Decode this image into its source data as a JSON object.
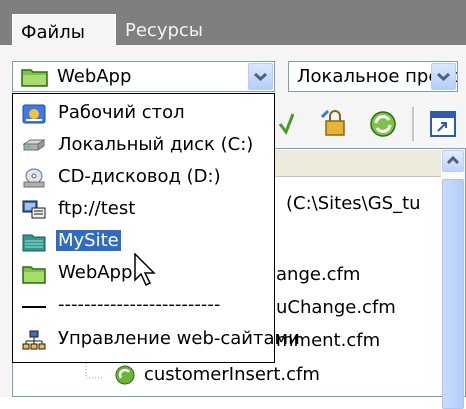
{
  "tabs": [
    {
      "label": "Файлы",
      "active": true
    },
    {
      "label": "Ресурсы",
      "active": false
    }
  ],
  "site_select": {
    "value": "WebApp"
  },
  "view_select": {
    "value": "Локальное представление"
  },
  "file_list": {
    "path_fragment": "(C:\\Sites\\GS_tu",
    "items": [
      "ange.cfm",
      "uChange.cfm",
      "mment.cfm",
      "customerInsert.cfm"
    ]
  },
  "dropdown": {
    "items": [
      {
        "label": "Рабочий стол",
        "icon": "desktop-icon"
      },
      {
        "label": "Локальный диск (C:)",
        "icon": "hard-drive-icon"
      },
      {
        "label": "CD-дисковод (D:)",
        "icon": "cd-drive-icon"
      },
      {
        "label": "ftp://test",
        "icon": "ftp-server-icon"
      },
      {
        "label": "MySite",
        "icon": "site-icon",
        "selected": true
      },
      {
        "label": "WebApp",
        "icon": "folder-icon"
      },
      {
        "label": "-------------------------",
        "icon": "line-icon"
      },
      {
        "label": "Управление web-сайтами",
        "icon": "manage-sites-icon"
      }
    ]
  },
  "colors": {
    "tab_strip": "#7f7f7f",
    "panel": "#f5f5f5",
    "selection": "#316ac5",
    "folder": "#7dc24b"
  }
}
